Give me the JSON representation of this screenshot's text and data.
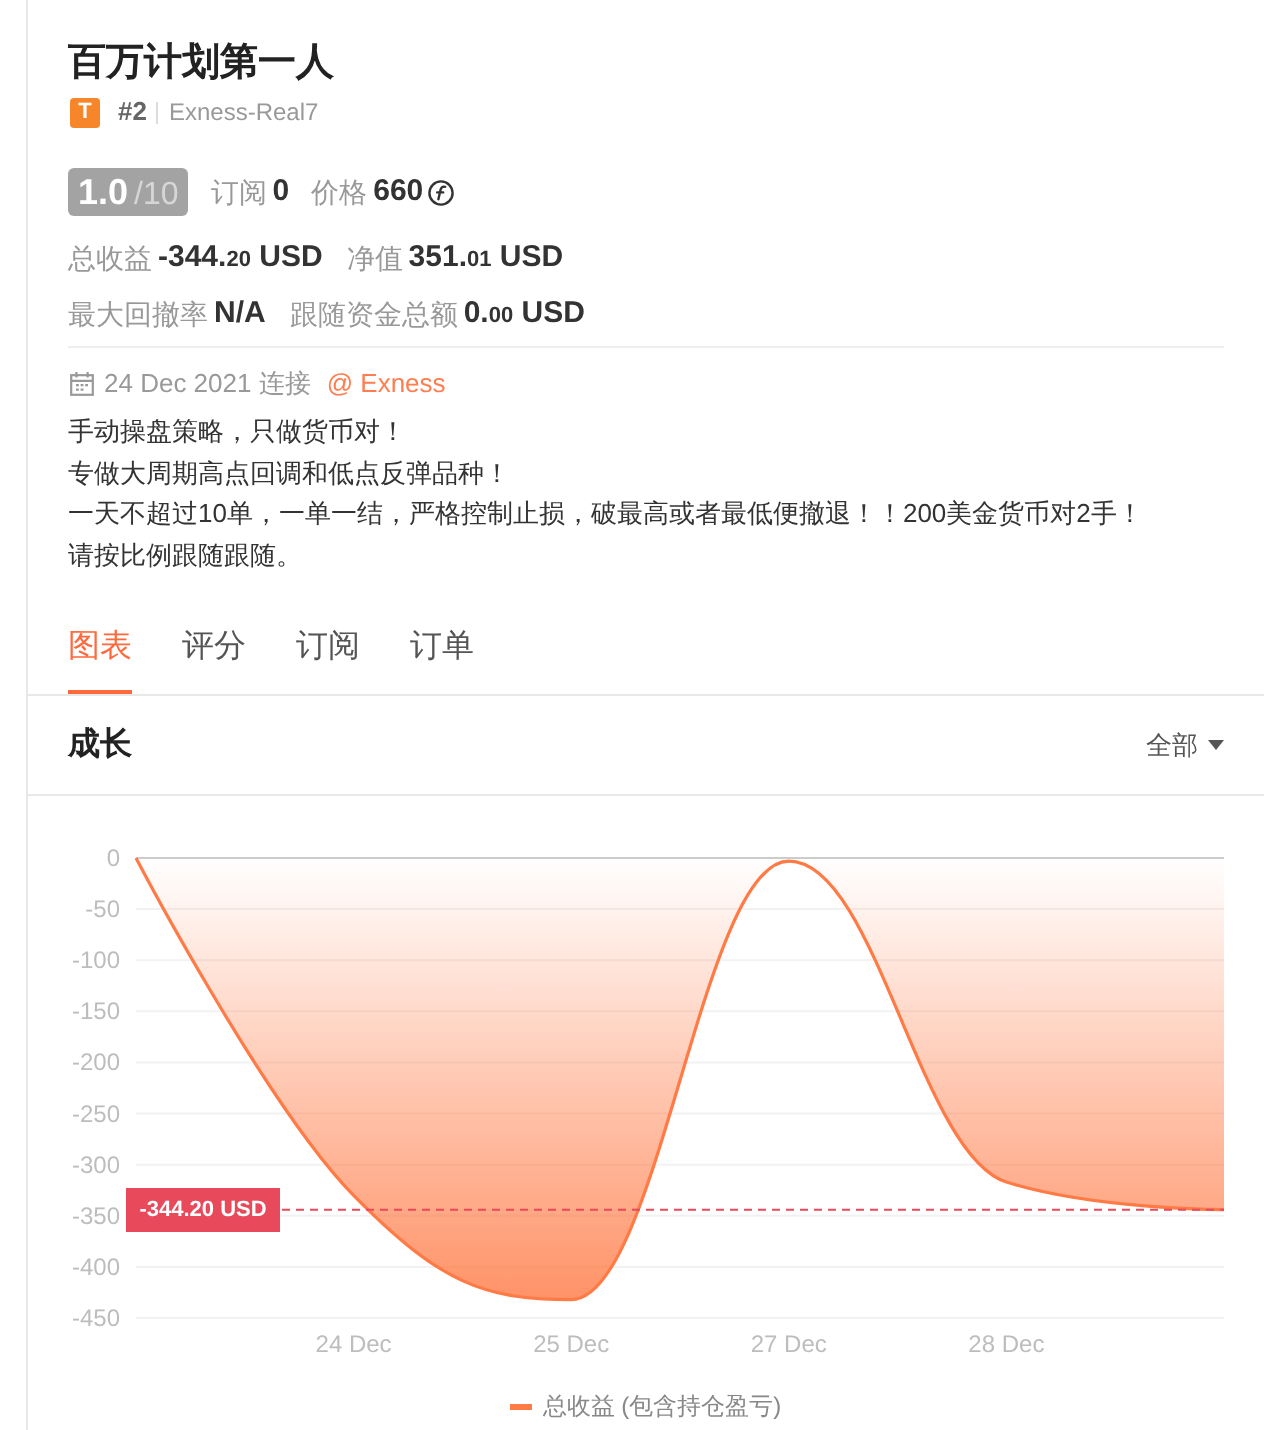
{
  "title": "百万计划第一人",
  "account": {
    "type_badge": "T",
    "rank": "#2",
    "server": "Exness-Real7"
  },
  "score": {
    "value": "1.0",
    "max": "/10"
  },
  "summary": [
    {
      "kind": "count",
      "label": "订阅",
      "value": "0"
    },
    {
      "kind": "price",
      "label": "价格",
      "value": "660"
    }
  ],
  "stats": [
    [
      {
        "label": "总收益",
        "value": "-344.20 USD"
      },
      {
        "label": "净值",
        "value": "351.01 USD"
      }
    ],
    [
      {
        "label": "最大回撤率",
        "value": "N/A"
      },
      {
        "label": "跟随资金总额",
        "value": "0.00 USD"
      }
    ]
  ],
  "connection": {
    "date": "24 Dec 2021 连接",
    "broker": "@ Exness"
  },
  "description": [
    "手动操盘策略，只做货币对！",
    "专做大周期高点回调和低点反弹品种！",
    "一天不超过10单，一单一结，严格控制止损，破最高或者最低便撤退！！200美金货币对2手！",
    "请按比例跟随跟随。"
  ],
  "tabs": [
    {
      "label": "图表",
      "selected": true
    },
    {
      "label": "评分",
      "selected": false
    },
    {
      "label": "订阅",
      "selected": false
    },
    {
      "label": "订单",
      "selected": false
    }
  ],
  "chart_panel": {
    "title": "成长",
    "range": "全部",
    "chart_data": {
      "type": "area",
      "categories": [
        null,
        "24 Dec",
        "25 Dec",
        "27 Dec",
        "28 Dec",
        null
      ],
      "ylim": [
        -450,
        0
      ],
      "yticks": [
        0,
        -50,
        -100,
        -150,
        -200,
        -250,
        -300,
        -350,
        -400,
        -450
      ],
      "grid": true,
      "series": [
        {
          "name": "总收益 (包含持仓盈亏)",
          "color": "#ff7a45",
          "values": [
            0,
            -330,
            -432,
            -3,
            -317,
            -344
          ]
        }
      ],
      "ref_lines": [
        {
          "axis": "y",
          "value": -344,
          "label": "-344.20 USD"
        }
      ]
    }
  }
}
